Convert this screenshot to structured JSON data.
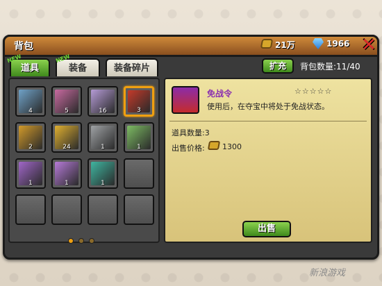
{
  "window": {
    "title": "背包"
  },
  "currency": {
    "gold": "21万",
    "gems": "1966"
  },
  "tabs": [
    {
      "label": "道具",
      "active": true,
      "new_badge": "NEW"
    },
    {
      "label": "装备",
      "active": false,
      "new_badge": "NEW"
    },
    {
      "label": "装备碎片",
      "active": false,
      "new_badge": ""
    }
  ],
  "toolbar": {
    "expand_label": "扩充",
    "capacity_text": "背包数量:11/40"
  },
  "inventory": [
    {
      "name": "book-stack",
      "count": "4",
      "color": "#6fa2c8"
    },
    {
      "name": "scroll-red",
      "count": "5",
      "color": "#c86aa0"
    },
    {
      "name": "scroll-white",
      "count": "16",
      "color": "#b59bd6"
    },
    {
      "name": "red-envelope",
      "count": "3",
      "color": "#c43a2a",
      "selected": true
    },
    {
      "name": "gold-card",
      "count": "2",
      "color": "#d29a2a"
    },
    {
      "name": "gold-badge",
      "count": "24",
      "color": "#e0b030"
    },
    {
      "name": "ghost-spirit",
      "count": "1",
      "color": "#9fa2a5"
    },
    {
      "name": "ghost-spirit-green",
      "count": "1",
      "color": "#7dbc63"
    },
    {
      "name": "purple-orbs",
      "count": "1",
      "color": "#a066c8"
    },
    {
      "name": "purple-orb",
      "count": "1",
      "color": "#b67ad8"
    },
    {
      "name": "teal-orb",
      "count": "1",
      "color": "#3fb5a0"
    }
  ],
  "pagination": {
    "current": 1,
    "total": 3
  },
  "detail": {
    "name": "免战令",
    "stars": "☆☆☆☆☆",
    "description": "使用后，在夺宝中将处于免战状态。",
    "quantity_text": "道具数量:3",
    "price_label": "出售价格:",
    "price_value": "1300",
    "sell_label": "出售"
  },
  "watermark": "新浪游戏",
  "colors": {
    "accent_green": "#5aa82c",
    "header_orange": "#b86b2a",
    "selected_gold": "#f0a010"
  }
}
